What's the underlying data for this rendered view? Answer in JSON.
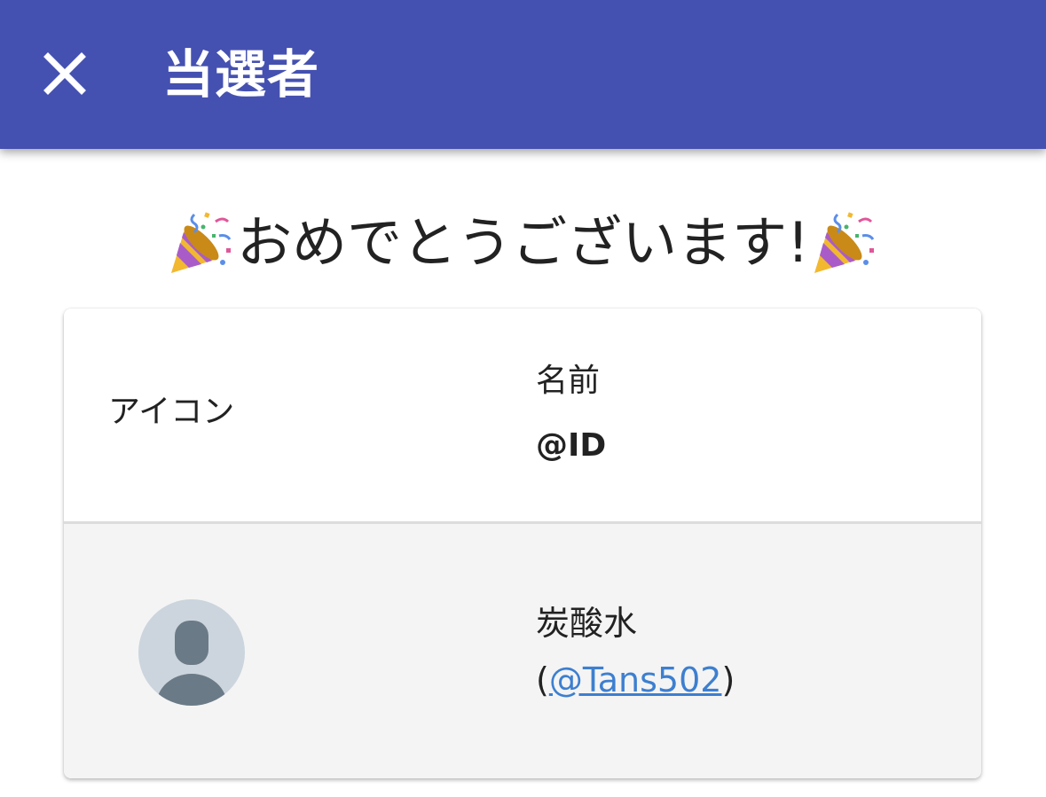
{
  "header": {
    "title": "当選者",
    "close_icon": "close-icon",
    "background_color": "#4551b1"
  },
  "congrats": {
    "message": "おめでとうございます!",
    "leading_icon": "party-popper-icon",
    "trailing_icon": "party-popper-icon"
  },
  "table": {
    "columns": {
      "icon_label": "アイコン",
      "name_label": "名前",
      "id_label": "@ID"
    },
    "rows": [
      {
        "avatar_icon": "default-avatar-icon",
        "name": "炭酸水",
        "paren_open": "(",
        "handle": "@Tans502",
        "paren_close": ")"
      }
    ]
  },
  "colors": {
    "link": "#3d7fd0",
    "row_background": "#f4f4f4"
  }
}
